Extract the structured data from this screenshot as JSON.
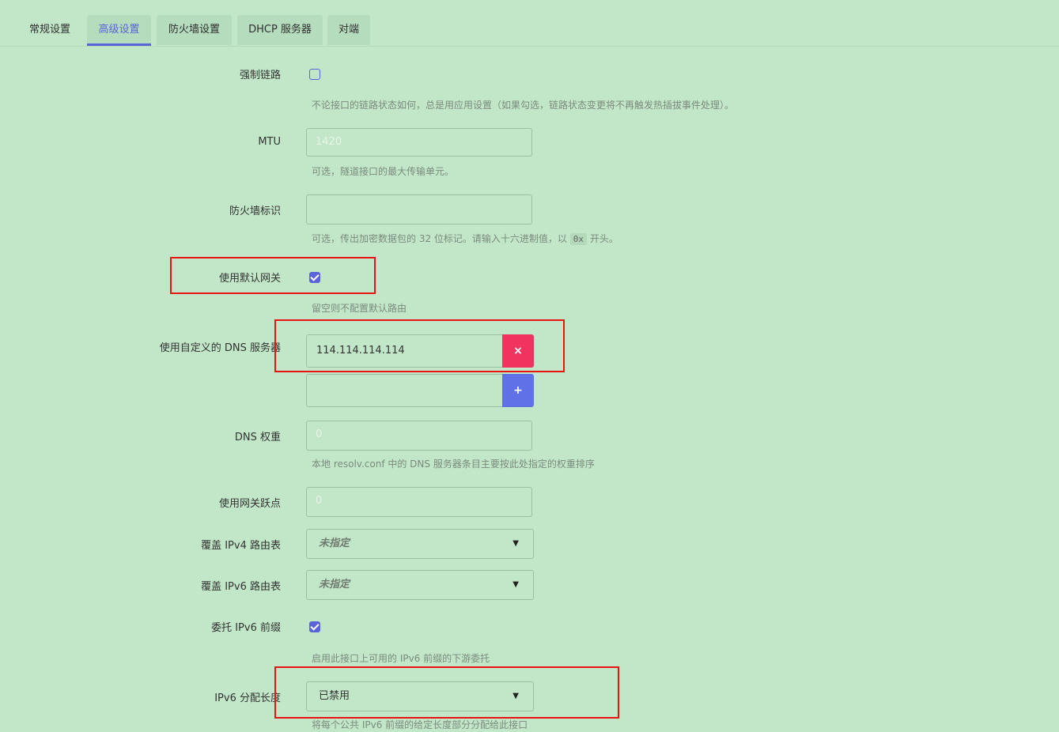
{
  "tabs": [
    "常规设置",
    "高级设置",
    "防火墙设置",
    "DHCP 服务器",
    "对端"
  ],
  "active_tab": "高级设置",
  "fields": {
    "force_link": {
      "label": "强制链路",
      "checked": false,
      "hint": "不论接口的链路状态如何，总是用应用设置（如果勾选，链路状态变更将不再触发热插拔事件处理）。"
    },
    "mtu": {
      "label": "MTU",
      "placeholder": "1420",
      "hint": "可选，隧道接口的最大传输单元。"
    },
    "fwmark": {
      "label": "防火墙标识",
      "value": "",
      "hint_prefix": "可选，传出加密数据包的 32 位标记。请输入十六进制值，以",
      "hint_code": "0x",
      "hint_suffix": "开头。"
    },
    "default_gw": {
      "label": "使用默认网关",
      "checked": true,
      "hint": "留空则不配置默认路由"
    },
    "custom_dns": {
      "label": "使用自定义的 DNS 服务器",
      "entries": [
        "114.114.114.114",
        ""
      ],
      "remove_symbol": "×",
      "add_symbol": "+"
    },
    "dns_weight": {
      "label": "DNS 权重",
      "placeholder": "0",
      "hint": "本地 resolv.conf 中的 DNS 服务器条目主要按此处指定的权重排序"
    },
    "gw_metric": {
      "label": "使用网关跃点",
      "placeholder": "0"
    },
    "ipv4_table": {
      "label": "覆盖 IPv4 路由表",
      "value": "未指定"
    },
    "ipv6_table": {
      "label": "覆盖 IPv6 路由表",
      "value": "未指定"
    },
    "delegate": {
      "label": "委托 IPv6 前缀",
      "checked": true,
      "hint": "启用此接口上可用的 IPv6 前缀的下游委托"
    },
    "ip6assign": {
      "label": "IPv6 分配长度",
      "value": "已禁用",
      "hint": "将每个公共 IPv6 前缀的给定长度部分分配给此接口"
    }
  },
  "dropdown_arrow": "▼",
  "colors": {
    "accent": "#5b63d8",
    "danger": "#f0335f",
    "add": "#6070e6",
    "highlight": "#e8140f",
    "background": "#c2e7c8"
  }
}
